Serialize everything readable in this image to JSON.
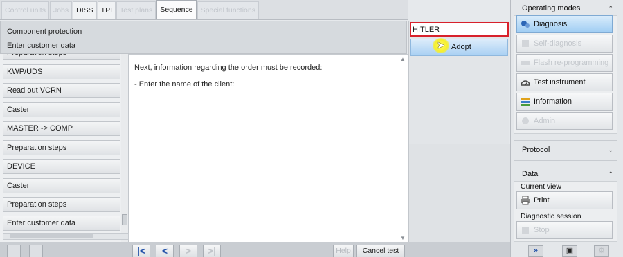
{
  "tabs": [
    {
      "label": "Control units",
      "state": "disabled"
    },
    {
      "label": "Jobs",
      "state": "disabled"
    },
    {
      "label": "DISS",
      "state": "enabled"
    },
    {
      "label": "TPI",
      "state": "enabled"
    },
    {
      "label": "Test plans",
      "state": "disabled"
    },
    {
      "label": "Sequence",
      "state": "selected"
    },
    {
      "label": "Special functions",
      "state": "disabled"
    }
  ],
  "header": {
    "line1": "Component protection",
    "line2": "Enter customer data"
  },
  "steps": [
    "Preparation steps",
    "KWP/UDS",
    "Read out VCRN",
    "Caster",
    "MASTER -> COMP",
    "Preparation steps",
    "DEVICE",
    "Caster",
    "Preparation steps",
    "Enter customer data"
  ],
  "main": {
    "line1": "Next, information regarding the order must be recorded:",
    "line2": "- Enter the name of the client:"
  },
  "input": {
    "value": "HITLER",
    "adopt_label": "Adopt"
  },
  "operating_modes": {
    "title": "Operating modes",
    "chevron": "up-chevron-icon",
    "buttons": [
      {
        "label": "Diagnosis",
        "icon": "stethoscope-icon",
        "state": "active"
      },
      {
        "label": "Self-diagnosis",
        "icon": "self-diagnosis-icon",
        "state": "disabled"
      },
      {
        "label": "Flash re-programming",
        "icon": "flash-icon",
        "state": "disabled"
      },
      {
        "label": "Test instrument",
        "icon": "gauge-icon",
        "state": "enabled"
      },
      {
        "label": "Information",
        "icon": "books-icon",
        "state": "enabled"
      },
      {
        "label": "Admin",
        "icon": "admin-icon",
        "state": "disabled"
      }
    ]
  },
  "protocol": {
    "title": "Protocol",
    "chevron": "down-chevron-icon"
  },
  "data_section": {
    "title": "Data",
    "chevron": "up-chevron-icon",
    "current_view_label": "Current view",
    "print_label": "Print",
    "diagnostic_session_label": "Diagnostic session",
    "stop_label": "Stop"
  },
  "bottom": {
    "help_label": "Help",
    "cancel_label": "Cancel test",
    "nav": {
      "first": "|<",
      "prev": "<",
      "next": ">",
      "last": ">|"
    }
  },
  "colors": {
    "input_border": "#d8212b",
    "active_button": "#9fcdf3",
    "nav_arrow": "#1f4fa8",
    "cursor_highlight": "#f6ef2a"
  }
}
